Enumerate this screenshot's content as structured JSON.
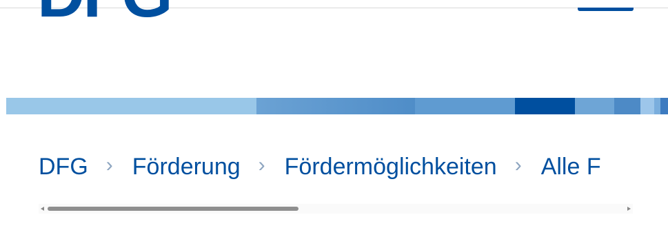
{
  "header": {
    "logo_text": "DFG",
    "menu_button_label": ""
  },
  "decor_stripe": {
    "colors": [
      "#99c7e8",
      "#6ba2d4",
      "#4f8dc8",
      "#5f9bd1",
      "#004f9f",
      "#6ea5d6",
      "#4d8ac6",
      "#9dc6ea",
      "#7aaedd",
      "#3d7bc0"
    ]
  },
  "breadcrumb": {
    "items": [
      "DFG",
      "Förderung",
      "Fördermöglichkeiten",
      "Alle F"
    ],
    "separator": "›"
  },
  "colors": {
    "brand": "#004f9f",
    "separator": "#8da5c0",
    "scroll_thumb": "#8f8f8f"
  }
}
